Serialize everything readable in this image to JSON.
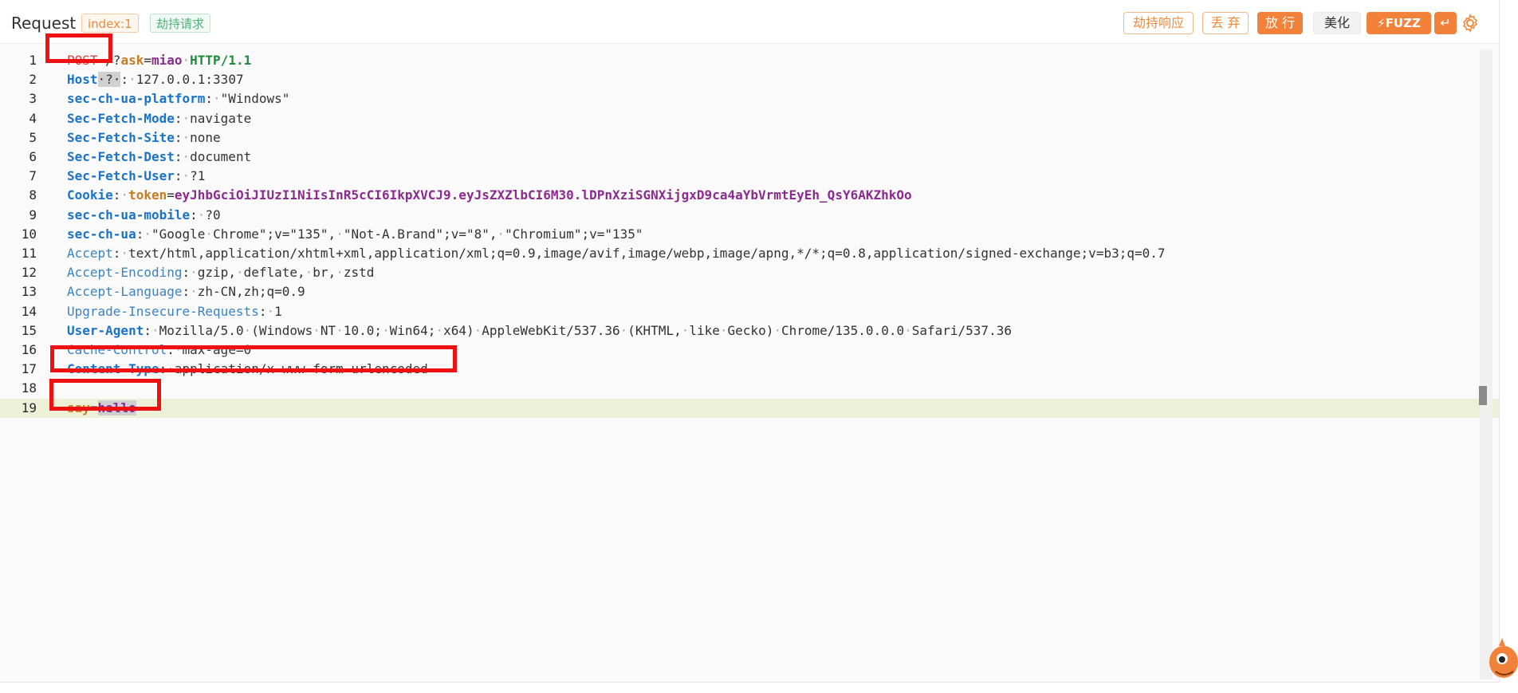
{
  "header": {
    "title": "Request",
    "index_tag": "index:1",
    "hijack_tag": "劫持请求",
    "buttons": {
      "hijack_response": "劫持响应",
      "discard": "丢 弃",
      "forward": "放 行",
      "beautify": "美化",
      "fuzz": "FUZZ",
      "wrap": "↵"
    },
    "icons": {
      "fuzz": "lightning-icon",
      "settings": "gear-icon"
    }
  },
  "editor": {
    "lines": [
      {
        "n": "1",
        "parts": [
          [
            "k-red",
            "POST"
          ],
          [
            "sp",
            "·"
          ],
          [
            "k-gray",
            "/?"
          ],
          [
            "k-orange",
            "ask"
          ],
          [
            "k-gray",
            "="
          ],
          [
            "k-purple",
            "miao"
          ],
          [
            "sp",
            "·"
          ],
          [
            "k-green",
            "HTTP/1.1"
          ]
        ]
      },
      {
        "n": "2",
        "parts": [
          [
            "k-blue",
            "Host"
          ],
          [
            "hlbox",
            "·?·"
          ],
          [
            "k-gray",
            ":"
          ],
          [
            "sp",
            "·"
          ],
          [
            "k-gray",
            "127.0.0.1:3307"
          ]
        ]
      },
      {
        "n": "3",
        "parts": [
          [
            "k-blue",
            "sec-ch-ua-platform"
          ],
          [
            "k-gray",
            ":"
          ],
          [
            "sp",
            "·"
          ],
          [
            "k-gray",
            "\"Windows\""
          ]
        ]
      },
      {
        "n": "4",
        "parts": [
          [
            "k-blue",
            "Sec-Fetch-Mode"
          ],
          [
            "k-gray",
            ":"
          ],
          [
            "sp",
            "·"
          ],
          [
            "k-gray",
            "navigate"
          ]
        ]
      },
      {
        "n": "5",
        "parts": [
          [
            "k-blue",
            "Sec-Fetch-Site"
          ],
          [
            "k-gray",
            ":"
          ],
          [
            "sp",
            "·"
          ],
          [
            "k-gray",
            "none"
          ]
        ]
      },
      {
        "n": "6",
        "parts": [
          [
            "k-blue",
            "Sec-Fetch-Dest"
          ],
          [
            "k-gray",
            ":"
          ],
          [
            "sp",
            "·"
          ],
          [
            "k-gray",
            "document"
          ]
        ]
      },
      {
        "n": "7",
        "parts": [
          [
            "k-blue",
            "Sec-Fetch-User"
          ],
          [
            "k-gray",
            ":"
          ],
          [
            "sp",
            "·"
          ],
          [
            "k-gray",
            "?1"
          ]
        ]
      },
      {
        "n": "8",
        "parts": [
          [
            "k-blue",
            "Cookie"
          ],
          [
            "k-gray",
            ":"
          ],
          [
            "sp",
            "·"
          ],
          [
            "k-orange",
            "token"
          ],
          [
            "k-gray",
            "="
          ],
          [
            "k-purple",
            "eyJhbGciOiJIUzI1NiIsInR5cCI6IkpXVCJ9.eyJsZXZlbCI6M30.lDPnXziSGNXijgxD9ca4aYbVrmtEyEh_QsY6AKZhkOo"
          ]
        ]
      },
      {
        "n": "9",
        "parts": [
          [
            "k-blue",
            "sec-ch-ua-mobile"
          ],
          [
            "k-gray",
            ":"
          ],
          [
            "sp",
            "·"
          ],
          [
            "k-gray",
            "?0"
          ]
        ]
      },
      {
        "n": "10",
        "parts": [
          [
            "k-blue",
            "sec-ch-ua"
          ],
          [
            "k-gray",
            ":"
          ],
          [
            "sp",
            "·"
          ],
          [
            "k-gray",
            "\"Google"
          ],
          [
            "sp",
            "·"
          ],
          [
            "k-gray",
            "Chrome\";v=\"135\","
          ],
          [
            "sp",
            "·"
          ],
          [
            "k-gray",
            "\"Not-A.Brand\";v=\"8\","
          ],
          [
            "sp",
            "·"
          ],
          [
            "k-gray",
            "\"Chromium\";v=\"135\""
          ]
        ]
      },
      {
        "n": "11",
        "parts": [
          [
            "k-blue2",
            "Accept"
          ],
          [
            "k-gray",
            ":"
          ],
          [
            "sp",
            "·"
          ],
          [
            "k-gray",
            "text/html,application/xhtml+xml,application/xml;q=0.9,image/avif,image/webp,image/apng,*/*;q=0.8,application/signed-exchange;v=b3;q=0.7"
          ]
        ]
      },
      {
        "n": "12",
        "parts": [
          [
            "k-blue2",
            "Accept-Encoding"
          ],
          [
            "k-gray",
            ":"
          ],
          [
            "sp",
            "·"
          ],
          [
            "k-gray",
            "gzip,"
          ],
          [
            "sp",
            "·"
          ],
          [
            "k-gray",
            "deflate,"
          ],
          [
            "sp",
            "·"
          ],
          [
            "k-gray",
            "br,"
          ],
          [
            "sp",
            "·"
          ],
          [
            "k-gray",
            "zstd"
          ]
        ]
      },
      {
        "n": "13",
        "parts": [
          [
            "k-blue2",
            "Accept-Language"
          ],
          [
            "k-gray",
            ":"
          ],
          [
            "sp",
            "·"
          ],
          [
            "k-gray",
            "zh-CN,zh;q=0.9"
          ]
        ]
      },
      {
        "n": "14",
        "parts": [
          [
            "k-blue2",
            "Upgrade-Insecure-Requests"
          ],
          [
            "k-gray",
            ":"
          ],
          [
            "sp",
            "·"
          ],
          [
            "k-gray",
            "1"
          ]
        ]
      },
      {
        "n": "15",
        "parts": [
          [
            "k-blue",
            "User-Agent"
          ],
          [
            "k-gray",
            ":"
          ],
          [
            "sp",
            "·"
          ],
          [
            "k-gray",
            "Mozilla/5.0"
          ],
          [
            "sp",
            "·"
          ],
          [
            "k-gray",
            "(Windows"
          ],
          [
            "sp",
            "·"
          ],
          [
            "k-gray",
            "NT"
          ],
          [
            "sp",
            "·"
          ],
          [
            "k-gray",
            "10.0;"
          ],
          [
            "sp",
            "·"
          ],
          [
            "k-gray",
            "Win64;"
          ],
          [
            "sp",
            "·"
          ],
          [
            "k-gray",
            "x64)"
          ],
          [
            "sp",
            "·"
          ],
          [
            "k-gray",
            "AppleWebKit/537.36"
          ],
          [
            "sp",
            "·"
          ],
          [
            "k-gray",
            "(KHTML,"
          ],
          [
            "sp",
            "·"
          ],
          [
            "k-gray",
            "like"
          ],
          [
            "sp",
            "·"
          ],
          [
            "k-gray",
            "Gecko)"
          ],
          [
            "sp",
            "·"
          ],
          [
            "k-gray",
            "Chrome/135.0.0.0"
          ],
          [
            "sp",
            "·"
          ],
          [
            "k-gray",
            "Safari/537.36"
          ]
        ]
      },
      {
        "n": "16",
        "parts": [
          [
            "k-blue2",
            "Cache-Control"
          ],
          [
            "k-gray",
            ":"
          ],
          [
            "sp",
            "·"
          ],
          [
            "k-gray",
            "max-age=0"
          ]
        ]
      },
      {
        "n": "17",
        "parts": [
          [
            "k-blue",
            "Content-Type"
          ],
          [
            "k-gray",
            ":"
          ],
          [
            "sp",
            "·"
          ],
          [
            "k-gray",
            "application/x-www-form-urlencoded"
          ]
        ]
      },
      {
        "n": "18",
        "parts": []
      },
      {
        "n": "19",
        "parts": [
          [
            "k-orange",
            "say"
          ],
          [
            "k-gray",
            "="
          ],
          [
            "k-purple cursorbox",
            "hello"
          ]
        ]
      }
    ]
  }
}
